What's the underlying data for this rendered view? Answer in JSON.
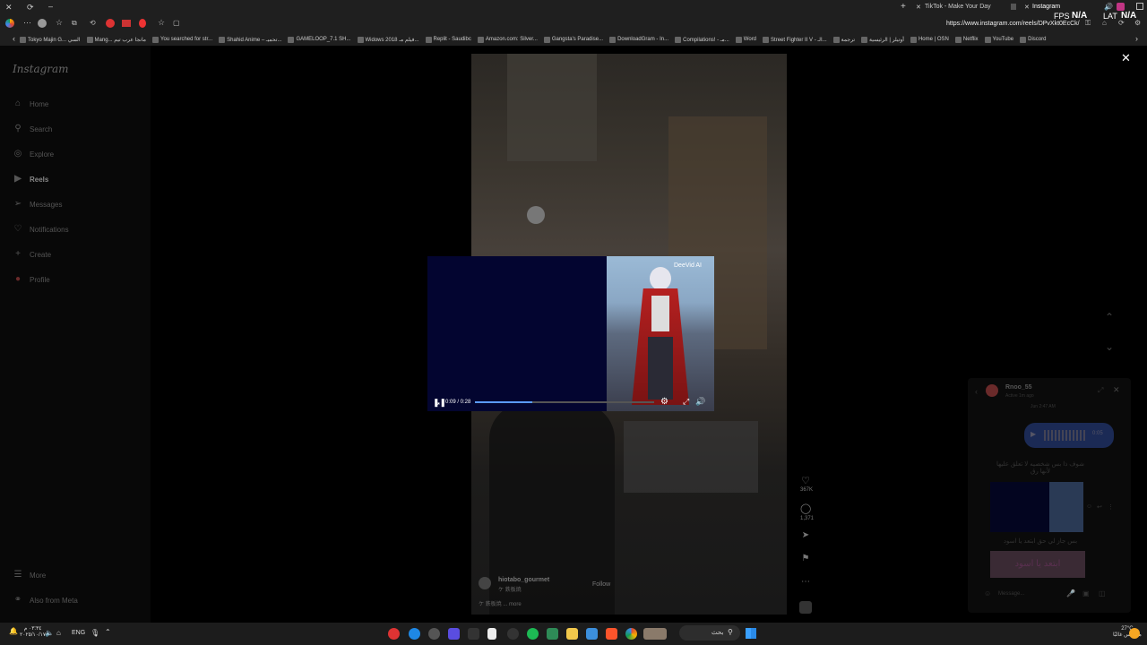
{
  "browser": {
    "tabs": [
      {
        "label": "TikTok - Make Your Day"
      },
      {
        "label": "Instagram"
      }
    ],
    "url": "https://www.instagram.com/reels/DPvXkt0EcCk/",
    "overlay": {
      "fps_label": "FPS",
      "fps_value": "N/A",
      "lat_label": "LAT",
      "lat_value": "N/A"
    },
    "bookmarks": [
      "Tokyo Majin G... السي",
      "Mang... مانجا عرب تيم",
      "You searched for str...",
      "Shahid Anime – تحميـ...",
      "GAMELOOP_7.1 SH...",
      "Widows 2018 فيلم مـ...",
      "Replit - Saudibc",
      "Amazon.com: Silver...",
      "Gangsta's Paradise...",
      "DownloadGram - In...",
      "Compilations! - مـ...",
      "Word",
      "Street Fighter II V - الـ...",
      "ترجمة",
      "أوتيلر | الرئيسية",
      "Home | OSN",
      "Netflix",
      "YouTube",
      "Discord"
    ]
  },
  "sidebar": {
    "logo": "Instagram",
    "items": [
      {
        "label": "Home",
        "icon": "home-icon"
      },
      {
        "label": "Search",
        "icon": "search-icon"
      },
      {
        "label": "Explore",
        "icon": "compass-icon"
      },
      {
        "label": "Reels",
        "icon": "reels-icon"
      },
      {
        "label": "Messages",
        "icon": "send-icon"
      },
      {
        "label": "Notifications",
        "icon": "heart-icon"
      },
      {
        "label": "Create",
        "icon": "plus-icon"
      },
      {
        "label": "Profile",
        "icon": "profile-icon"
      }
    ],
    "more": "More",
    "meta": "Also from Meta"
  },
  "reel": {
    "likes": "367K",
    "comments": "1,371",
    "username": "hiotabo_gourmet",
    "subtitle": "ケ 鉄板焼",
    "follow": "Follow",
    "caption": "ケ 鉄板焼 ... more"
  },
  "pip": {
    "time": "0:09 / 0:28",
    "watermark": "DeeVid AI",
    "progress": 0.32
  },
  "chat": {
    "name": "Rnoo_55",
    "status": "Active 1m ago",
    "time": "Jun 2:47 AM",
    "voice_duration": "0:05",
    "msg1": "شوف ذا بس شخصيه لا تعلق عليها لأنها رق",
    "msg2": "بس جاز لي حق ابتعد يا اسود",
    "image_text": "ابتعد يا اسود",
    "placeholder": "Message..."
  },
  "taskbar": {
    "search": "بحث",
    "time": "٠٣:٣٤ م",
    "date": "٢٠٢٥/١٠/١٧",
    "lang": "ENG",
    "temp": "27°C",
    "weather": "مشمس غالبًا"
  }
}
